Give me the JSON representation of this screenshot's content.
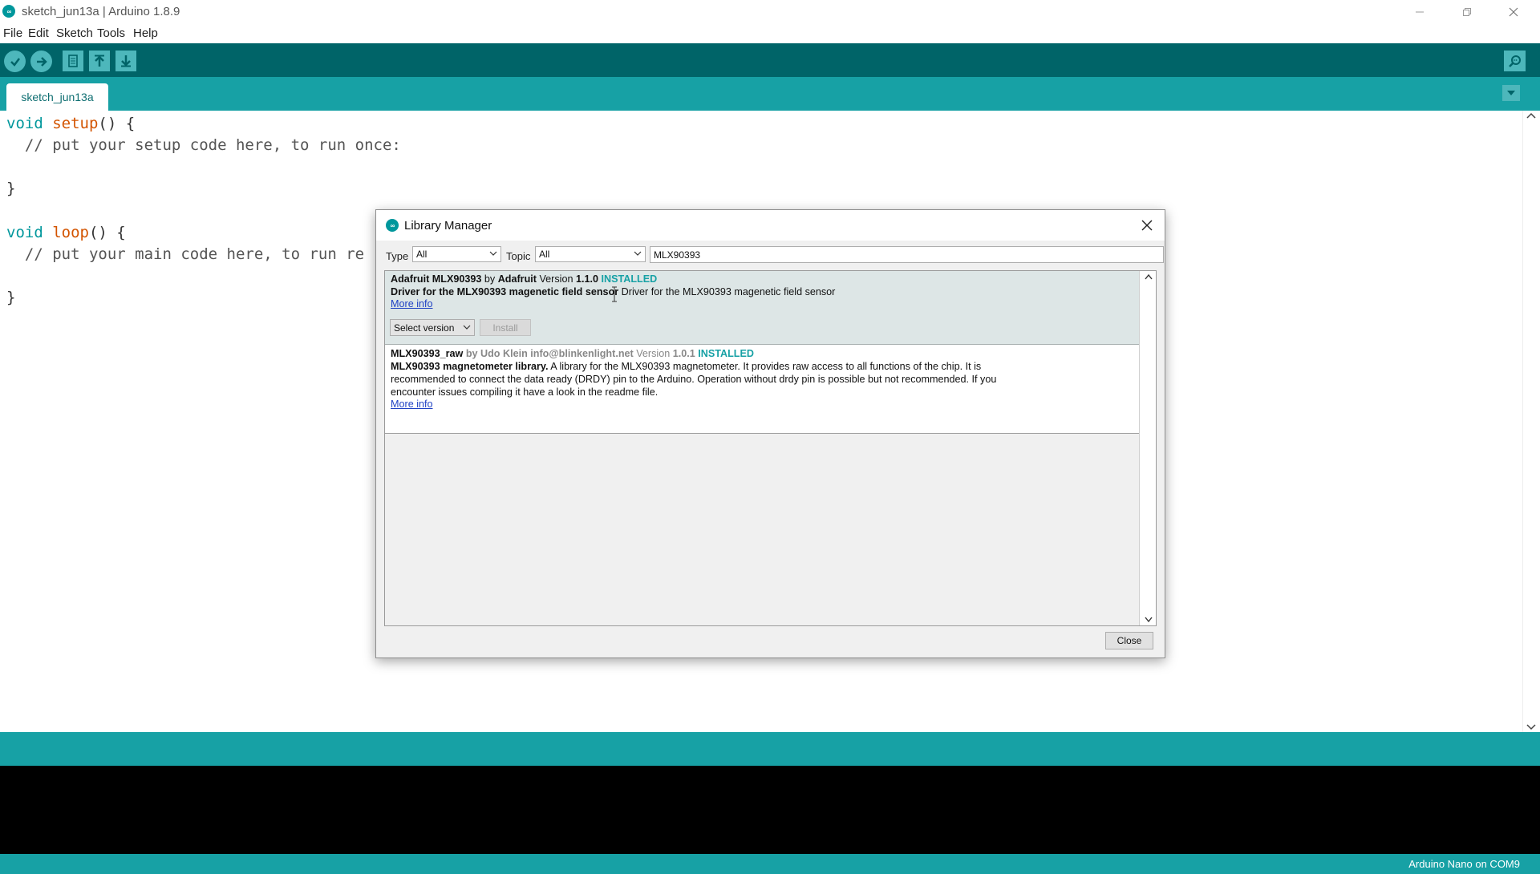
{
  "window": {
    "title": "sketch_jun13a | Arduino 1.8.9",
    "logo_text": "∞",
    "controls": {
      "minimize": "—",
      "maximize": "❐",
      "close": "✕"
    }
  },
  "menu": [
    "File",
    "Edit",
    "Sketch",
    "Tools",
    "Help"
  ],
  "toolbar": {
    "buttons": [
      "verify-icon",
      "upload-icon",
      "new-icon",
      "open-icon",
      "save-icon"
    ],
    "right": "serial-monitor-icon"
  },
  "tabs": [
    {
      "label": "sketch_jun13a"
    }
  ],
  "editor": {
    "lines": [
      {
        "kw": "void",
        "fn": "setup",
        "rest": "() {"
      },
      {
        "comment": "  // put your setup code here, to run once:"
      },
      {
        "rest": "}"
      },
      {
        "kw": "void",
        "fn": "loop",
        "rest": "() {"
      },
      {
        "comment": "  // put your main code here, to run re"
      },
      {
        "rest": "}"
      }
    ]
  },
  "status": {
    "board": "Arduino Nano on COM9"
  },
  "dialog": {
    "title": "Library Manager",
    "logo_text": "∞",
    "type_label": "Type",
    "type_value": "All",
    "topic_label": "Topic",
    "topic_value": "All",
    "search_value": "MLX90393",
    "libraries": [
      {
        "name": "Adafruit MLX90393",
        "by_label": "by",
        "author": "Adafruit",
        "version_label": "Version",
        "version": "1.1.0",
        "status": "INSTALLED",
        "summary": "Driver for the MLX90393 magenetic field sensor",
        "description": "Driver for the MLX90393 magenetic field sensor",
        "more_info": "More info",
        "version_select": "Select version",
        "install_label": "Install"
      },
      {
        "name": "MLX90393_raw",
        "by_label": "by",
        "author": "Udo Klein",
        "email": "info@blinkenlight.net",
        "version_label": "Version",
        "version": "1.0.1",
        "status": "INSTALLED",
        "summary": "MLX90393 magnetometer library.",
        "description_lines": [
          "A library for the MLX90393 magnetometer. It provides raw access to all functions of the chip. It is",
          "recommended to connect the data ready (DRDY) pin to the Arduino. Operation without drdy pin is possible but not recommended. If you",
          "encounter issues compiling it have a look in the readme file."
        ],
        "more_info": "More info"
      }
    ],
    "close_label": "Close"
  }
}
